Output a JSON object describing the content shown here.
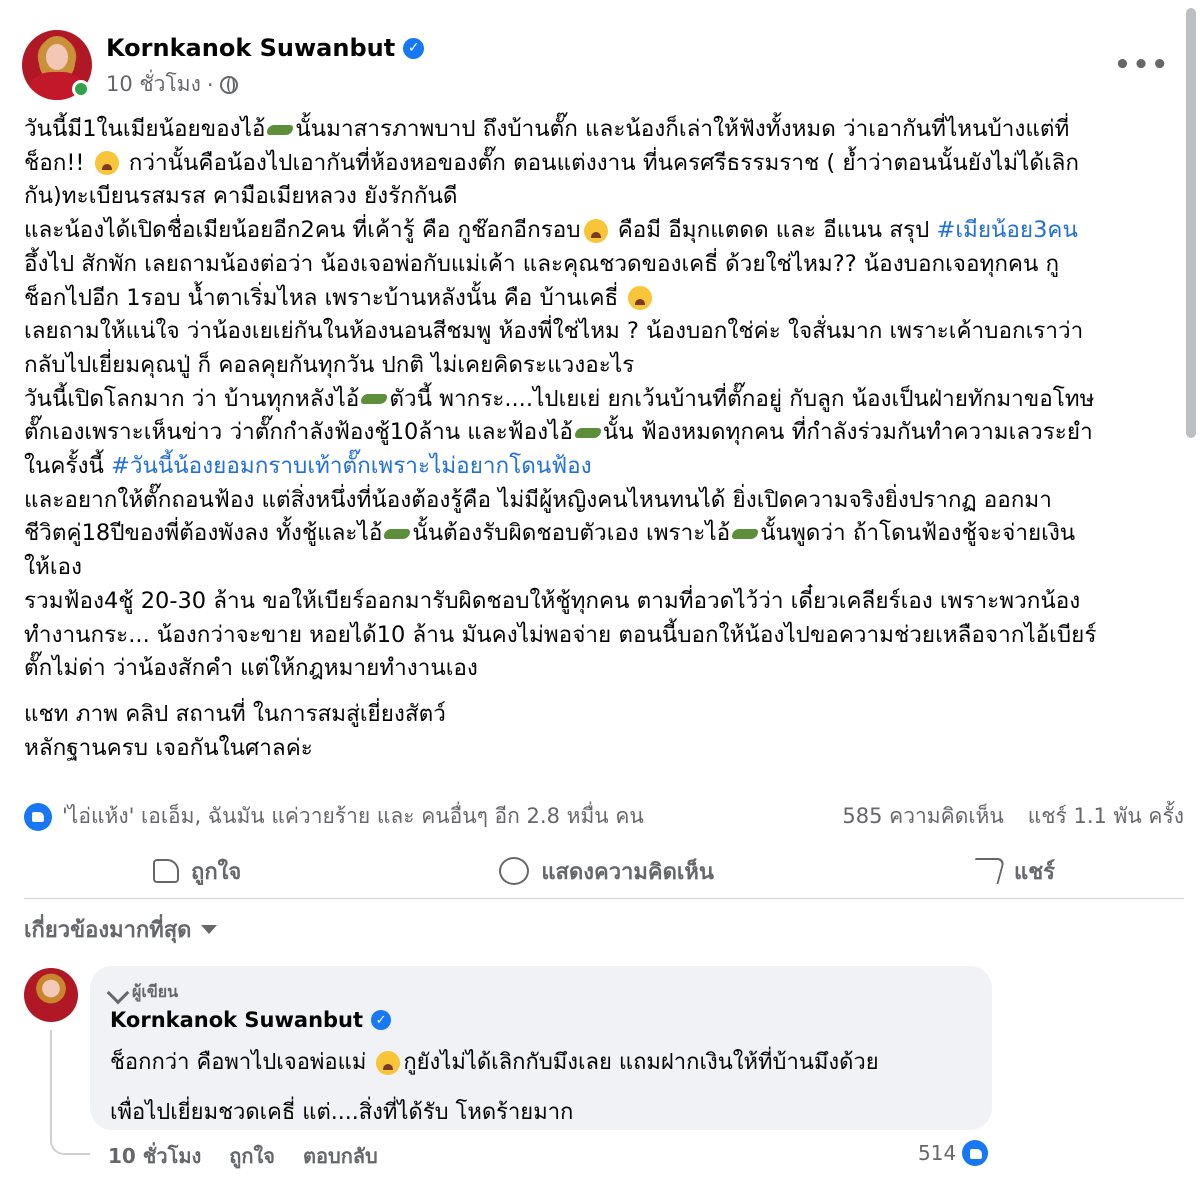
{
  "post": {
    "author": "Kornkanok Suwanbut",
    "time": "10 ชั่วโมง",
    "dot": "·",
    "more": "•••",
    "lines": [
      [
        "วันนี้มี1ในเมียน้อยของไอ้",
        "CROC",
        "นั้นมาสารภาพบาป ถึงบ้านตั๊ก และน้องก็เล่าให้ฟังทั้งหมด ว่าเอากันที่ไหนบ้างแต่ที่"
      ],
      [
        "ช็อก!! ",
        "EMOJI",
        " กว่านั้นคือน้องไปเอากันที่ห้องหอของตั๊ก ตอนแต่งงาน ที่นครศรีธรรมราช ( ย้ำว่าตอนนั้นยังไม่ได้เลิก"
      ],
      [
        "กัน)ทะเบียนรสมรส คามือเมียหลวง ยังรักกันดี"
      ],
      [
        "และน้องได้เปิดชื่อเมียน้อยอีก2คน ที่เค้ารู้ คือ กูช๊อกอีกรอบ",
        "EMOJI",
        " คือมี อีมุกแตดด และ อีแนน สรุป ",
        "#เมียน้อย3คน"
      ],
      [
        "อึ้งไป สักพัก  เลยถามน้องต่อว่า น้องเจอพ่อกับแม่เค้า และคุณชวดของเคธี่ ด้วยใช่ไหม?? น้องบอกเจอทุกคน กู"
      ],
      [
        "ช็อกไปอีก 1รอบ น้ำตาเริ่มไหล เพราะบ้านหลังนั้น คือ บ้านเคธี่ ",
        "EMOJI"
      ],
      [
        "เลยถามให้แน่ใจ ว่าน้องเยเย่กันในห้องนอนสีชมพู ห้องพี่ใช่ไหม ? น้องบอกใช่ค่ะ ใจสั่นมาก เพราะเค้าบอกเราว่า"
      ],
      [
        "กลับไปเยี่ยมคุณปู่ ก็ คอลคุยกันทุกวัน ปกติ ไม่เคยคิดระแวงอะไร"
      ],
      [
        "วันนี้เปิดโลกมาก ว่า บ้านทุกหลังไอ้",
        "CROC",
        "ตัวนี้ พากระ....ไปเยเย่ ยกเว้นบ้านที่ตั๊กอยู่ กับลูก น้องเป็นฝ่ายทักมาขอโทษ"
      ],
      [
        "ตั๊กเองเพราะเห็นข่าว ว่าตั๊กกำลังฟ้องชู้10ล้าน และฟ้องไอ้",
        "CROC",
        "นั้น ฟ้องหมดทุกคน ที่กำลังร่วมกันทำความเลวระยำ"
      ],
      [
        "ในครั้งนี้ ",
        "#วันนี้น้องยอมกราบเท้าตั๊กเพราะไม่อยากโดนฟ้อง"
      ],
      [
        "และอยากให้ตั๊กถอนฟ้อง แต่สิ่งหนึ่งที่น้องต้องรู้คือ ไม่มีผู้หญิงคนไหนทนได้ ยิ่งเปิดความจริงยิ่งปรากฏ ออกมา"
      ],
      [
        "ชีวิตคู่18ปีของพี่ต้องพังลง ทั้งชู้และไอ้",
        "CROC",
        "นั้นต้องรับผิดชอบตัวเอง เพราะไอ้",
        "CROC",
        "นั้นพูดว่า ถ้าโดนฟ้องชู้จะจ่ายเงิน"
      ],
      [
        "ให้เอง"
      ],
      [
        "รวมฟ้อง4ชู้ 20-30 ล้าน ขอให้เบียร์ออกมารับผิดชอบให้ชู้ทุกคน ตามที่อวดไว้ว่า เดี๋ยวเคลียร์เอง เพราะพวกน้อง"
      ],
      [
        "ทำงานกระ... น้องกว่าจะขาย หอยได้10 ล้าน มันคงไม่พอจ่าย  ตอนนี้บอกให้น้องไปขอความช่วยเหลือจากไอ้เบียร์"
      ],
      [
        "ตั๊กไม่ด่า ว่าน้องสักคำ แต่ให้กฎหมายทำงานเอง"
      ],
      [
        "GAP"
      ],
      [
        "แชท ภาพ คลิป สถานที่ ในการสมสู่เยี่ยงสัตว์"
      ],
      [
        "หลักฐานครบ เจอกันในศาลค่ะ"
      ]
    ]
  },
  "reactions": {
    "summary": "'ไอ่แห้ง' เอเอ็ม, ฉันมัน แค่วายร้าย และ คนอื่นๆ อีก 2.8 หมื่น คน",
    "comments": "585 ความคิดเห็น",
    "shares": "แชร์ 1.1 พัน ครั้ง"
  },
  "actions": {
    "like": "ถูกใจ",
    "comment": "แสดงความคิดเห็น",
    "share": "แชร์"
  },
  "sort": {
    "label": "เกี่ยวข้องมากที่สุด"
  },
  "comment": {
    "tag": "ผู้เขียน",
    "author": "Kornkanok Suwanbut",
    "line1a": "ช็อกกว่า คือพาไปเจอพ่อแม่ ",
    "line1b": "กูยังไม่ได้เลิกกับมึงเลย แถมฝากเงินให้ที่บ้านมึงด้วย",
    "line2": "เพื่อไปเยี่ยมชวดเคธี่ แต่....สิ่งที่ได้รับ โหดร้ายมาก",
    "time": "10 ชั่วโมง",
    "like": "ถูกใจ",
    "reply": "ตอบกลับ",
    "count": "514"
  },
  "colors": {
    "accent": "#1877f2",
    "hashtag": "#216fdb",
    "muted": "#65676b"
  }
}
